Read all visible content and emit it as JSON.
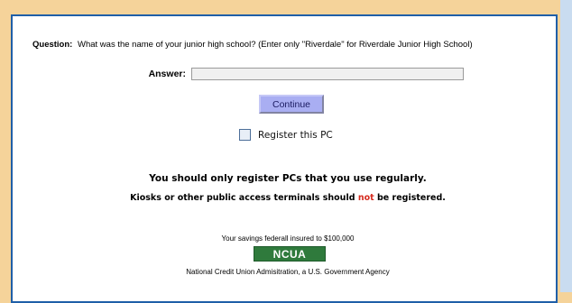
{
  "form": {
    "question_label": "Question:",
    "question_text": "What was the name of your junior high school? (Enter only \"Riverdale\" for Riverdale Junior High School)",
    "answer_label": "Answer:",
    "answer_value": "",
    "continue_label": "Continue",
    "register_checked": false,
    "register_label": "Register this PC"
  },
  "notice": {
    "line1": "You should only register PCs that you use regularly.",
    "line2_pre": "Kiosks or other public access terminals should ",
    "line2_emph": "not",
    "line2_post": " be registered."
  },
  "footer": {
    "insured_text": "Your savings federall insured to $100,000",
    "logo_text": "NCUA",
    "agency_text": "National Credit Union Admisitration, a U.S. Government Agency"
  },
  "colors": {
    "page_background": "#f5d39a",
    "panel_border": "#1f5fa8",
    "button_background": "#a9aef2",
    "emphasis_red": "#d62b1f",
    "logo_green": "#2f7a3c"
  }
}
